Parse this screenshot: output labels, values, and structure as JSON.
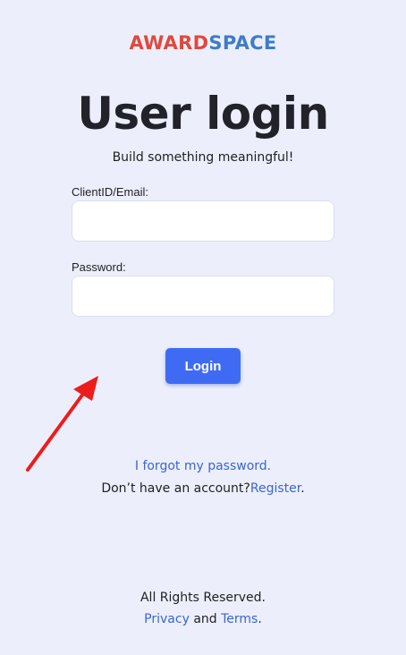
{
  "logo": {
    "part1": "AWARD",
    "part2": "SPACE"
  },
  "header": {
    "title": "User login",
    "subtitle": "Build something meaningful!"
  },
  "form": {
    "email_label": "ClientID/Email:",
    "email_value": "",
    "password_label": "Password:",
    "password_value": "",
    "login_label": "Login"
  },
  "links": {
    "forgot": "I forgot my password.",
    "no_account": "Don’t have an account?",
    "register": "Register",
    "register_suffix": "."
  },
  "footer": {
    "rights": "All Rights Reserved.",
    "privacy": "Privacy",
    "and": " and ",
    "terms": "Terms",
    "suffix": "."
  },
  "colors": {
    "background": "#eceffb",
    "logo_red": "#e0483f",
    "logo_blue": "#3d7cc9",
    "button": "#3f6bf4",
    "link": "#3a64d6",
    "annotation_arrow": "#ee1c1c"
  },
  "icons": {
    "annotation": "red-arrow-icon"
  }
}
